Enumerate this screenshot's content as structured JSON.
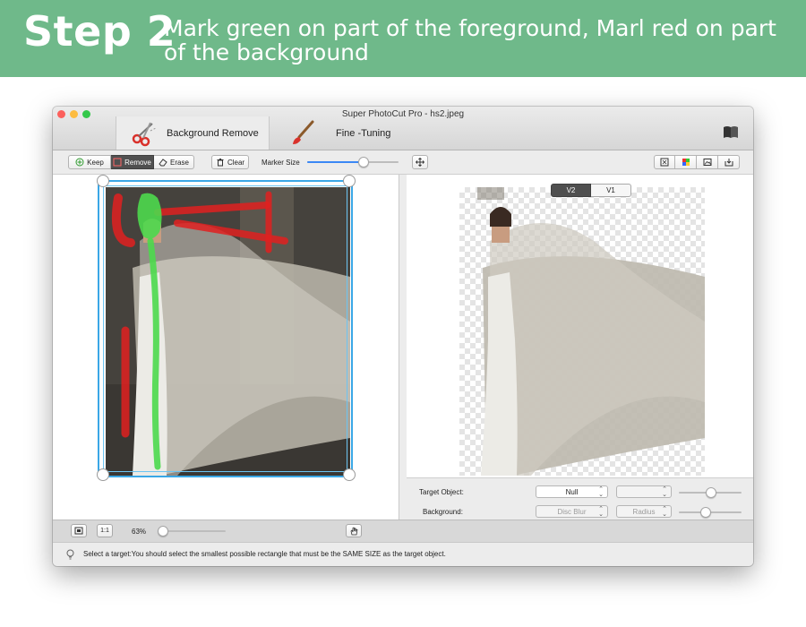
{
  "banner": {
    "step": "Step 2",
    "description": "Mark green on part of the foreground, Marl red on part of the background"
  },
  "window": {
    "title": "Super PhotoCut Pro - hs2.jpeg",
    "tabs": [
      {
        "label": "Background Remove",
        "icon": "scissors-icon",
        "active": true
      },
      {
        "label": "Fine -Tuning",
        "icon": "brush-icon",
        "active": false
      }
    ],
    "help_icon": "book-icon"
  },
  "toolbar": {
    "keep_label": "Keep",
    "remove_label": "Remove",
    "erase_label": "Erase",
    "clear_label": "Clear",
    "marker_size_label": "Marker Size",
    "marker_size_value": 0.62,
    "active_mode": "Remove",
    "right_tools": [
      "fit-icon",
      "color-icon",
      "image-icon",
      "export-icon"
    ]
  },
  "result": {
    "versions": [
      "V2",
      "V1"
    ],
    "active_version": "V2"
  },
  "settings": {
    "target_object_label": "Target Object:",
    "target_object_value": "Null",
    "background_label": "Background:",
    "background_value": "Disc Blur",
    "radius_value": "Radius"
  },
  "bottombar": {
    "actual_size_label": "1:1",
    "zoom_label": "63%",
    "zoom_value": 0.08
  },
  "status": {
    "text": "Select a target:You should select the smallest possible rectangle that must be the SAME SIZE as the target object."
  },
  "colors": {
    "banner": "#6fb98a",
    "selection": "#3aa7e6",
    "keep_mark": "#4cd94c",
    "remove_mark": "#e02020",
    "slider_fill": "#3b88f5"
  }
}
